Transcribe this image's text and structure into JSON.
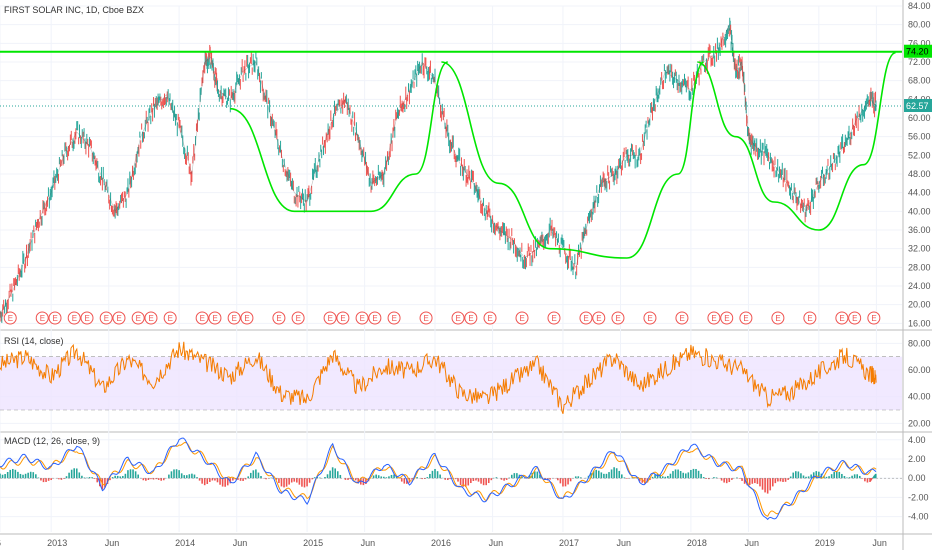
{
  "header": {
    "title": "FIRST SOLAR INC, 1D, Cboe BZX"
  },
  "colors": {
    "candle_up": "#26a69a",
    "candle_down": "#ef5350",
    "pattern": "#00e600",
    "rsi_line": "#f57c00",
    "rsi_band": "#eee4ff",
    "macd_line": "#2962ff",
    "signal_line": "#ff9800",
    "hist_up": "#26a69a",
    "hist_down": "#ef5350",
    "earnings": "#ef5350",
    "last_price_badge": "#26a69a",
    "resistance_badge": "#00e600"
  },
  "chart_data": [
    {
      "type": "line",
      "name": "price",
      "title": "FIRST SOLAR INC, 1D, Cboe BZX",
      "ylim": [
        15,
        84
      ],
      "y_ticks": [
        "84.00",
        "80.00",
        "76.00",
        "72.00",
        "68.00",
        "64.00",
        "60.00",
        "56.00",
        "52.00",
        "48.00",
        "44.00",
        "40.00",
        "36.00",
        "32.00",
        "28.00",
        "24.00",
        "20.00",
        "16.00"
      ],
      "x_ticks": [
        "6",
        "2013",
        "Jun",
        "2014",
        "Jun",
        "2015",
        "Jun",
        "2016",
        "Jun",
        "2017",
        "Jun",
        "2018",
        "Jun",
        "2019",
        "Jun"
      ],
      "resistance": {
        "value": 74.2,
        "label": "74.20"
      },
      "last_price": {
        "value": 62.57,
        "label": "62.57"
      },
      "series": [
        {
          "x": [
            2012.6,
            2012.7,
            2012.8,
            2012.9,
            2013.0,
            2013.1,
            2013.2,
            2013.3,
            2013.4,
            2013.5,
            2013.6,
            2013.7,
            2013.8,
            2013.9,
            2014.0,
            2014.1,
            2014.2,
            2014.25,
            2014.3,
            2014.4,
            2014.5,
            2014.6,
            2014.7,
            2014.8,
            2014.9,
            2015.0,
            2015.1,
            2015.2,
            2015.3,
            2015.4,
            2015.5,
            2015.6,
            2015.7,
            2015.8,
            2015.9,
            2016.0,
            2016.1,
            2016.2,
            2016.3,
            2016.4,
            2016.5,
            2016.6,
            2016.7,
            2016.8,
            2016.9,
            2017.0,
            2017.1,
            2017.2,
            2017.3,
            2017.4,
            2017.5,
            2017.6,
            2017.7,
            2017.8,
            2017.9,
            2018.0,
            2018.1,
            2018.2,
            2018.3,
            2018.35,
            2018.4,
            2018.45,
            2018.5,
            2018.6,
            2018.7,
            2018.8,
            2018.9,
            2019.0,
            2019.1,
            2019.2,
            2019.3,
            2019.4,
            2019.45
          ],
          "values": [
            18,
            23,
            30,
            38,
            44,
            52,
            57,
            54,
            47,
            40,
            44,
            56,
            62,
            65,
            58,
            48,
            72,
            73,
            66,
            64,
            70,
            72,
            62,
            52,
            44,
            42,
            52,
            60,
            64,
            56,
            46,
            48,
            60,
            66,
            72,
            68,
            56,
            50,
            46,
            40,
            36,
            34,
            30,
            32,
            36,
            32,
            28,
            38,
            46,
            48,
            52,
            52,
            62,
            70,
            68,
            66,
            72,
            74,
            80,
            70,
            72,
            56,
            54,
            52,
            48,
            44,
            40,
            46,
            50,
            54,
            60,
            64,
            62.57
          ]
        }
      ],
      "events": {
        "label": "E",
        "x": [
          2012.68,
          2012.93,
          2013.03,
          2013.18,
          2013.28,
          2013.43,
          2013.53,
          2013.68,
          2013.78,
          2013.93,
          2014.18,
          2014.28,
          2014.43,
          2014.53,
          2014.78,
          2014.93,
          2015.18,
          2015.28,
          2015.43,
          2015.53,
          2015.68,
          2015.93,
          2016.18,
          2016.28,
          2016.43,
          2016.68,
          2016.93,
          2017.18,
          2017.28,
          2017.43,
          2017.68,
          2017.93,
          2018.18,
          2018.28,
          2018.43,
          2018.68,
          2018.93,
          2019.18,
          2019.28,
          2019.43
        ]
      }
    },
    {
      "type": "line",
      "name": "rsi",
      "title": "RSI (14, close)",
      "ylim": [
        15,
        87
      ],
      "band": [
        30,
        70
      ],
      "y_ticks": [
        "80.00",
        "60.00",
        "40.00",
        "20.00"
      ],
      "series": [
        {
          "x": [
            2012.6,
            2012.8,
            2013.0,
            2013.2,
            2013.4,
            2013.6,
            2013.8,
            2014.0,
            2014.2,
            2014.4,
            2014.6,
            2014.8,
            2015.0,
            2015.2,
            2015.4,
            2015.6,
            2015.8,
            2016.0,
            2016.2,
            2016.4,
            2016.6,
            2016.8,
            2017.0,
            2017.2,
            2017.4,
            2017.6,
            2017.8,
            2018.0,
            2018.2,
            2018.4,
            2018.6,
            2018.8,
            2019.0,
            2019.2,
            2019.4,
            2019.45
          ],
          "values": [
            64,
            70,
            55,
            75,
            46,
            68,
            52,
            76,
            66,
            55,
            71,
            42,
            38,
            72,
            46,
            63,
            59,
            69,
            43,
            38,
            52,
            64,
            33,
            52,
            70,
            48,
            61,
            73,
            67,
            60,
            39,
            44,
            58,
            71,
            57,
            54
          ]
        }
      ]
    },
    {
      "type": "line",
      "name": "macd",
      "title": "MACD (12, 26, close, 9)",
      "ylim": [
        -5.6,
        4.6
      ],
      "y_ticks": [
        "4.00",
        "2.00",
        "0.00",
        "-2.00",
        "-4.00"
      ],
      "series": [
        {
          "x": [
            2012.6,
            2012.8,
            2013.0,
            2013.2,
            2013.4,
            2013.6,
            2013.8,
            2014.0,
            2014.2,
            2014.4,
            2014.6,
            2014.8,
            2015.0,
            2015.2,
            2015.4,
            2015.6,
            2015.8,
            2016.0,
            2016.2,
            2016.4,
            2016.6,
            2016.8,
            2017.0,
            2017.2,
            2017.4,
            2017.6,
            2017.8,
            2018.0,
            2018.2,
            2018.4,
            2018.6,
            2018.8,
            2019.0,
            2019.2,
            2019.4,
            2019.45
          ],
          "values": [
            1.5,
            2.2,
            1.0,
            3.5,
            -1.0,
            2.0,
            0.5,
            4.2,
            2.0,
            -0.6,
            2.4,
            -1.4,
            -2.4,
            3.4,
            -0.8,
            1.4,
            -0.4,
            2.4,
            -1.2,
            -2.2,
            -0.6,
            1.0,
            -2.4,
            0.2,
            3.0,
            -0.6,
            1.0,
            3.5,
            1.6,
            0.8,
            -4.6,
            -2.2,
            0.4,
            1.6,
            0.5,
            0.9
          ]
        },
        {
          "x": [
            2012.6,
            2012.8,
            2013.0,
            2013.2,
            2013.4,
            2013.6,
            2013.8,
            2014.0,
            2014.2,
            2014.4,
            2014.6,
            2014.8,
            2015.0,
            2015.2,
            2015.4,
            2015.6,
            2015.8,
            2016.0,
            2016.2,
            2016.4,
            2016.6,
            2016.8,
            2017.0,
            2017.2,
            2017.4,
            2017.6,
            2017.8,
            2018.0,
            2018.2,
            2018.4,
            2018.6,
            2018.8,
            2019.0,
            2019.2,
            2019.4,
            2019.45
          ],
          "values": [
            1.2,
            1.9,
            1.2,
            3.1,
            -0.6,
            1.6,
            0.7,
            3.8,
            2.2,
            -0.3,
            2.1,
            -1.1,
            -2.1,
            3.0,
            -0.5,
            1.2,
            -0.2,
            2.1,
            -0.9,
            -2.0,
            -0.7,
            0.8,
            -2.1,
            0.0,
            2.6,
            -0.4,
            0.8,
            3.1,
            1.7,
            0.9,
            -4.0,
            -2.4,
            0.2,
            1.4,
            0.6,
            0.8
          ]
        }
      ]
    }
  ]
}
